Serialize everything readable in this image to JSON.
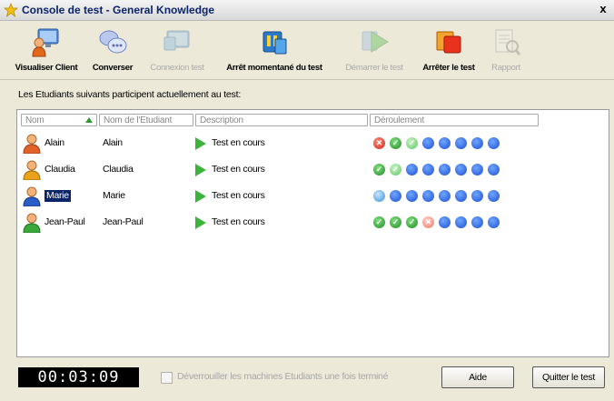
{
  "window": {
    "title": "Console de test - General Knowledge",
    "close_label": "x"
  },
  "toolbar": {
    "items": [
      {
        "label": "Visualiser Client",
        "icon": "monitor-user-icon",
        "enabled": true
      },
      {
        "label": "Converser",
        "icon": "chat-bubbles-icon",
        "enabled": true
      },
      {
        "label": "Connexion test",
        "icon": "connection-screen-icon",
        "enabled": false
      },
      {
        "label": "Arrêt momentané du test",
        "icon": "pause-test-icon",
        "enabled": true
      },
      {
        "label": "Démarrer le test",
        "icon": "start-test-icon",
        "enabled": false
      },
      {
        "label": "Arrêter le test",
        "icon": "stop-test-icon",
        "enabled": true
      },
      {
        "label": "Rapport",
        "icon": "report-icon",
        "enabled": false
      }
    ]
  },
  "intro_text": "Les Etudiants suivants participent actuellement au test:",
  "list": {
    "columns": [
      "Nom",
      "Nom de l'Etudiant",
      "Description",
      "Déroulement"
    ],
    "rows": [
      {
        "name": "Alain",
        "student_name": "Alain",
        "description": "Test en cours",
        "progress": [
          "fail",
          "done",
          "done-light",
          "pending",
          "pending",
          "pending",
          "pending",
          "pending"
        ]
      },
      {
        "name": "Claudia",
        "student_name": "Claudia",
        "description": "Test en cours",
        "progress": [
          "done",
          "done-light",
          "pending",
          "pending",
          "pending",
          "pending",
          "pending",
          "pending"
        ]
      },
      {
        "name": "Marie",
        "student_name": "Marie",
        "description": "Test en cours",
        "progress": [
          "current",
          "pending",
          "pending",
          "pending",
          "pending",
          "pending",
          "pending",
          "pending"
        ],
        "selected": true
      },
      {
        "name": "Jean-Paul",
        "student_name": "Jean-Paul",
        "description": "Test en cours",
        "progress": [
          "done",
          "done",
          "done",
          "fail-light",
          "pending",
          "pending",
          "pending",
          "pending"
        ]
      }
    ]
  },
  "footer": {
    "timer": "00:03:09",
    "unlock_checkbox_label": "Déverrouiller les machines Etudiants une fois terminé",
    "unlock_checked": false,
    "help_label": "Aide",
    "quit_label": "Quitter le test"
  },
  "colors": {
    "title_text": "#0a246a",
    "progress_done": "#228b22",
    "progress_fail": "#d0281a",
    "progress_pending": "#1d4fd1",
    "play_icon": "#3cb43c"
  }
}
